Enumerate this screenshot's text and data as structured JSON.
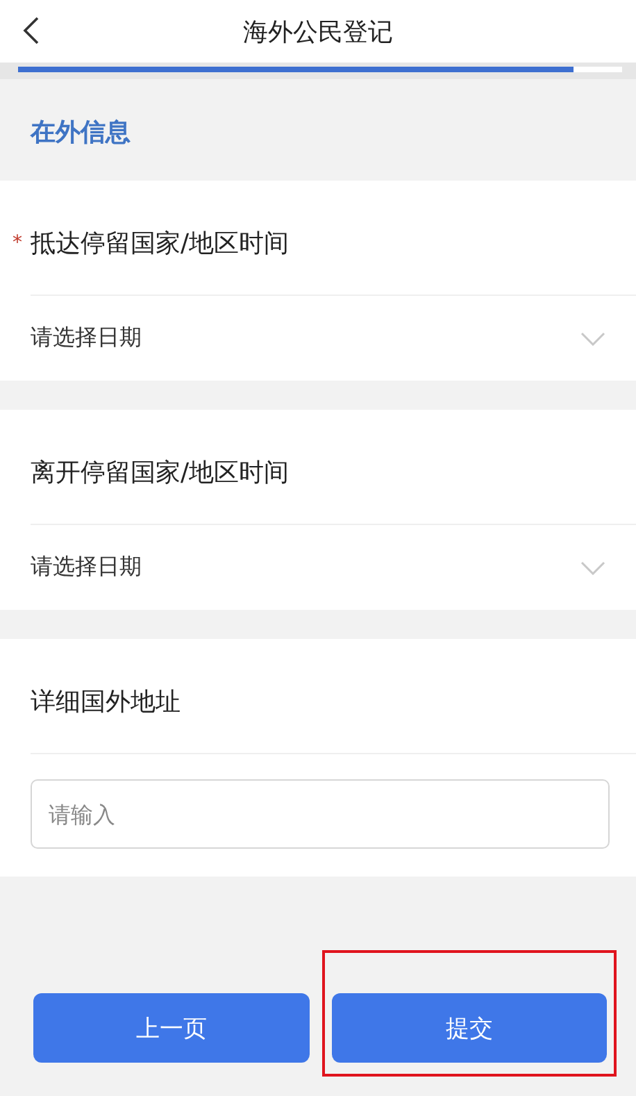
{
  "header": {
    "title": "海外公民登记"
  },
  "progress": {
    "level": 0.92
  },
  "section_title": "在外信息",
  "fields": [
    {
      "kind": "date",
      "label": "抵达停留国家/地区时间",
      "required_mark": "*",
      "placeholder": "请选择日期"
    },
    {
      "kind": "date",
      "label": "离开停留国家/地区时间",
      "placeholder": "请选择日期"
    },
    {
      "kind": "text",
      "label": "详细国外地址",
      "placeholder": "请输入"
    }
  ],
  "buttons": [
    {
      "label": "上一页",
      "highlighted": false
    },
    {
      "label": "提交",
      "highlighted": true
    }
  ]
}
